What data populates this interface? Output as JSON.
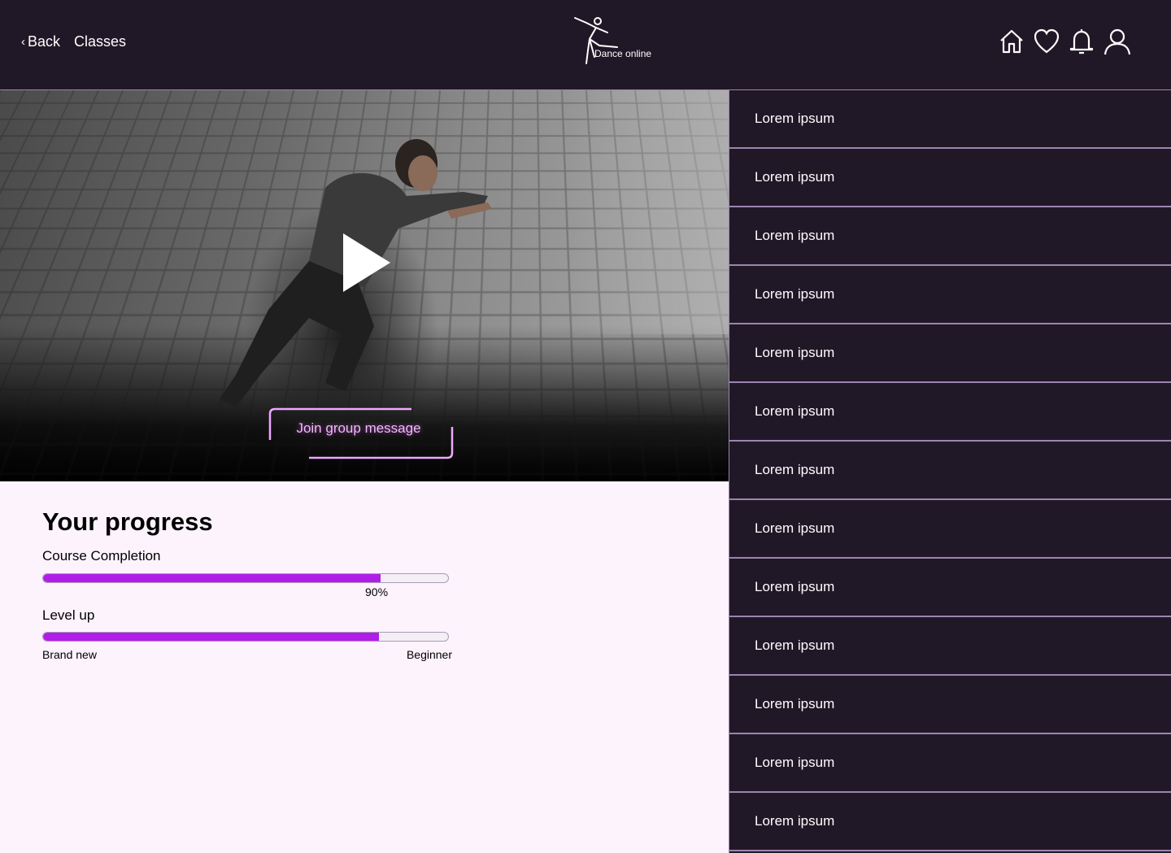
{
  "header": {
    "back_label": "Back",
    "classes_label": "Classes",
    "logo_text": "Dance online",
    "icons": [
      "home-icon",
      "heart-icon",
      "bell-icon",
      "user-icon"
    ]
  },
  "video": {
    "join_label": "Join group message"
  },
  "progress": {
    "title": "Your progress",
    "course_completion_label": "Course Completion",
    "course_completion_value": 0.9,
    "course_completion_pct_text": "90%",
    "level_label": "Level up",
    "level_value": 0.83,
    "level_start": "Brand new",
    "level_end": "Beginner"
  },
  "lessons": [
    "Lorem ipsum",
    "Lorem ipsum",
    "Lorem ipsum",
    "Lorem ipsum",
    "Lorem ipsum",
    "Lorem ipsum",
    "Lorem ipsum",
    "Lorem ipsum",
    "Lorem ipsum",
    "Lorem ipsum",
    "Lorem ipsum",
    "Lorem ipsum",
    "Lorem ipsum"
  ],
  "colors": {
    "header_bg": "#211827",
    "accent": "#b11de8",
    "divider": "#9a85b0",
    "page_bg": "#fdf3fd"
  }
}
